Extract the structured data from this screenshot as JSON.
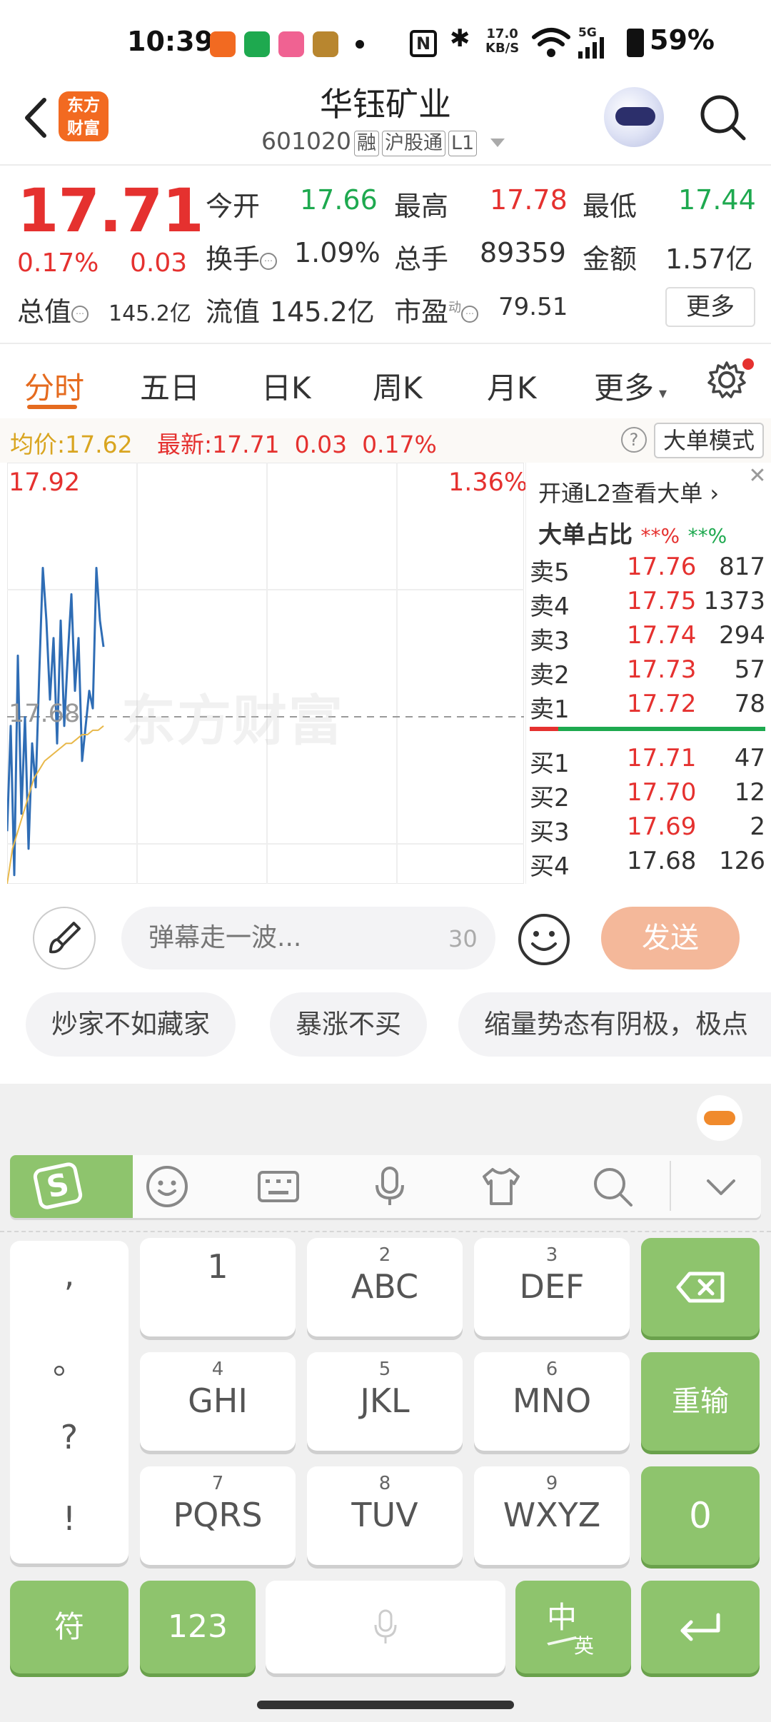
{
  "status_bar": {
    "time": "10:39",
    "speed": "17.0\nKB/S",
    "network": "5G",
    "battery": "59%"
  },
  "header": {
    "logo_text": "东方\n财富",
    "stock_name": "华钰矿业",
    "stock_code": "601020",
    "tags": [
      "融",
      "沪股通",
      "L1"
    ]
  },
  "quote": {
    "price": "17.71",
    "change_pct": "0.17%",
    "change": "0.03",
    "open_label": "今开",
    "open": "17.66",
    "high_label": "最高",
    "high": "17.78",
    "low_label": "最低",
    "low": "17.44",
    "turnover_label": "换手",
    "turnover": "1.09%",
    "volume_label": "总手",
    "volume": "89359",
    "amount_label": "金额",
    "amount": "1.57亿",
    "mktcap_label": "总值",
    "mktcap": "145.2亿",
    "float_label": "流值",
    "float": "145.2亿",
    "pe_label": "市盈",
    "pe_sup": "动",
    "pe": "79.51",
    "more": "更多"
  },
  "tabs": [
    "分时",
    "五日",
    "日K",
    "周K",
    "月K",
    "更多"
  ],
  "chart_info": {
    "avg_label": "均价:",
    "avg": "17.62",
    "latest_label": "最新:",
    "latest": "17.71",
    "latest_chg": "0.03",
    "latest_pct": "0.17%",
    "big_mode": "大单模式",
    "help": "?"
  },
  "chart_data": {
    "type": "line",
    "y_top_label": "17.92",
    "pct_top_label": "1.36%",
    "y_ref_label": "17.68",
    "watermark": "东方财富",
    "ylim": [
      17.44,
      17.92
    ],
    "series": [
      {
        "values": [
          17.5,
          17.62,
          17.45,
          17.7,
          17.52,
          17.63,
          17.48,
          17.6,
          17.55,
          17.68,
          17.8,
          17.74,
          17.65,
          17.72,
          17.6,
          17.74,
          17.62,
          17.7,
          17.77,
          17.66,
          17.72,
          17.58,
          17.62,
          17.66,
          17.64,
          17.8,
          17.74,
          17.71
        ]
      },
      {
        "values": [
          17.44,
          17.48,
          17.5,
          17.52,
          17.54,
          17.56,
          17.57,
          17.58,
          17.585,
          17.59,
          17.595,
          17.6,
          17.6,
          17.605,
          17.61,
          17.61,
          17.615,
          17.615,
          17.62
        ]
      }
    ]
  },
  "order_book": {
    "promo": "开通L2查看大单 ›",
    "close": "✕",
    "ratio_label": "大单占比",
    "ratio_red": "**%",
    "ratio_green": "**%",
    "asks": [
      {
        "label": "卖5",
        "price": "17.76",
        "vol": "817"
      },
      {
        "label": "卖4",
        "price": "17.75",
        "vol": "1373"
      },
      {
        "label": "卖3",
        "price": "17.74",
        "vol": "294"
      },
      {
        "label": "卖2",
        "price": "17.73",
        "vol": "57"
      },
      {
        "label": "卖1",
        "price": "17.72",
        "vol": "78"
      }
    ],
    "bids": [
      {
        "label": "买1",
        "price": "17.71",
        "vol": "47"
      },
      {
        "label": "买2",
        "price": "17.70",
        "vol": "12"
      },
      {
        "label": "买3",
        "price": "17.69",
        "vol": "2"
      },
      {
        "label": "买4",
        "price": "17.68",
        "vol": "126"
      }
    ]
  },
  "danmu": {
    "placeholder": "弹幕走一波...",
    "count": "30",
    "send": "发送",
    "chips": [
      "炒家不如藏家",
      "暴涨不买",
      "缩量势态有阴极，极点"
    ]
  },
  "keyboard": {
    "punct": [
      ",",
      "。",
      "?",
      "!"
    ],
    "keys": [
      {
        "num": "",
        "main": "1"
      },
      {
        "num": "2",
        "main": "ABC"
      },
      {
        "num": "3",
        "main": "DEF"
      },
      {
        "num": "4",
        "main": "GHI"
      },
      {
        "num": "5",
        "main": "JKL"
      },
      {
        "num": "6",
        "main": "MNO"
      },
      {
        "num": "7",
        "main": "PQRS"
      },
      {
        "num": "8",
        "main": "TUV"
      },
      {
        "num": "9",
        "main": "WXYZ"
      }
    ],
    "reenter": "重输",
    "zero": "0",
    "symbol": "符",
    "num123": "123",
    "lang_zh": "中",
    "lang_en": "英",
    "accent": "#8ec46d"
  },
  "colors": {
    "up": "#e5312f",
    "down": "#1ea94f",
    "brand": "#f26a21",
    "avg_line": "#e8b84a",
    "price_line": "#2f6db5"
  }
}
